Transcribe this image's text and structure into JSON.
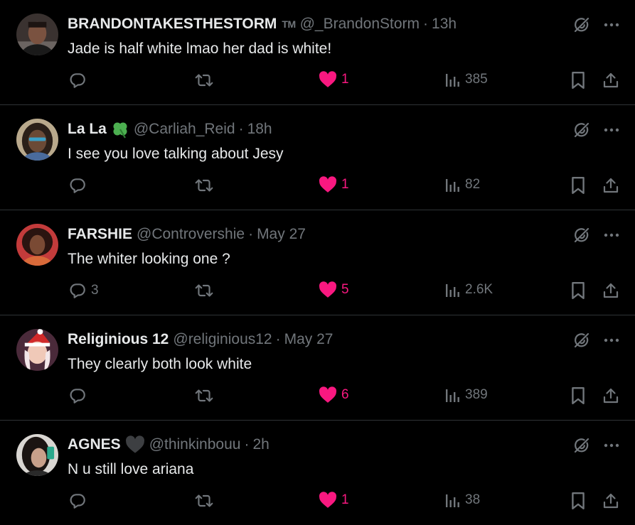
{
  "colors": {
    "background": "#000000",
    "primary_text": "#e7e9ea",
    "secondary_text": "#71767b",
    "like_pink": "#f91880",
    "divider": "#2f3336"
  },
  "tweets": [
    {
      "name": "BRANDONTAKESTHESTORM",
      "name_suffix": "TM",
      "handle": "@_BrandonStorm",
      "separator": "·",
      "time": "13h",
      "text": "Jade is half white lmao her dad is white!",
      "replies": "",
      "retweets": "",
      "likes": "1",
      "views": "385"
    },
    {
      "name": "La La",
      "name_emoji": "shamrock-icon",
      "handle": "@Carliah_Reid",
      "separator": "·",
      "time": "18h",
      "text": "I see you love talking about Jesy",
      "replies": "",
      "retweets": "",
      "likes": "1",
      "views": "82"
    },
    {
      "name": "FARSHIE",
      "handle": "@Controvershie",
      "separator": "·",
      "time": "May 27",
      "text": "The whiter looking one ?",
      "replies": "3",
      "retweets": "",
      "likes": "5",
      "views": "2.6K"
    },
    {
      "name": "Religinious 12",
      "handle": "@religinious12",
      "separator": "·",
      "time": "May 27",
      "text": "They clearly both look white",
      "replies": "",
      "retweets": "",
      "likes": "6",
      "views": "389"
    },
    {
      "name": "AGNES",
      "name_emoji": "black-heart-icon",
      "handle": "@thinkinbouu",
      "separator": "·",
      "time": "2h",
      "text": "N u still love ariana",
      "replies": "",
      "retweets": "",
      "likes": "1",
      "views": "38"
    }
  ]
}
